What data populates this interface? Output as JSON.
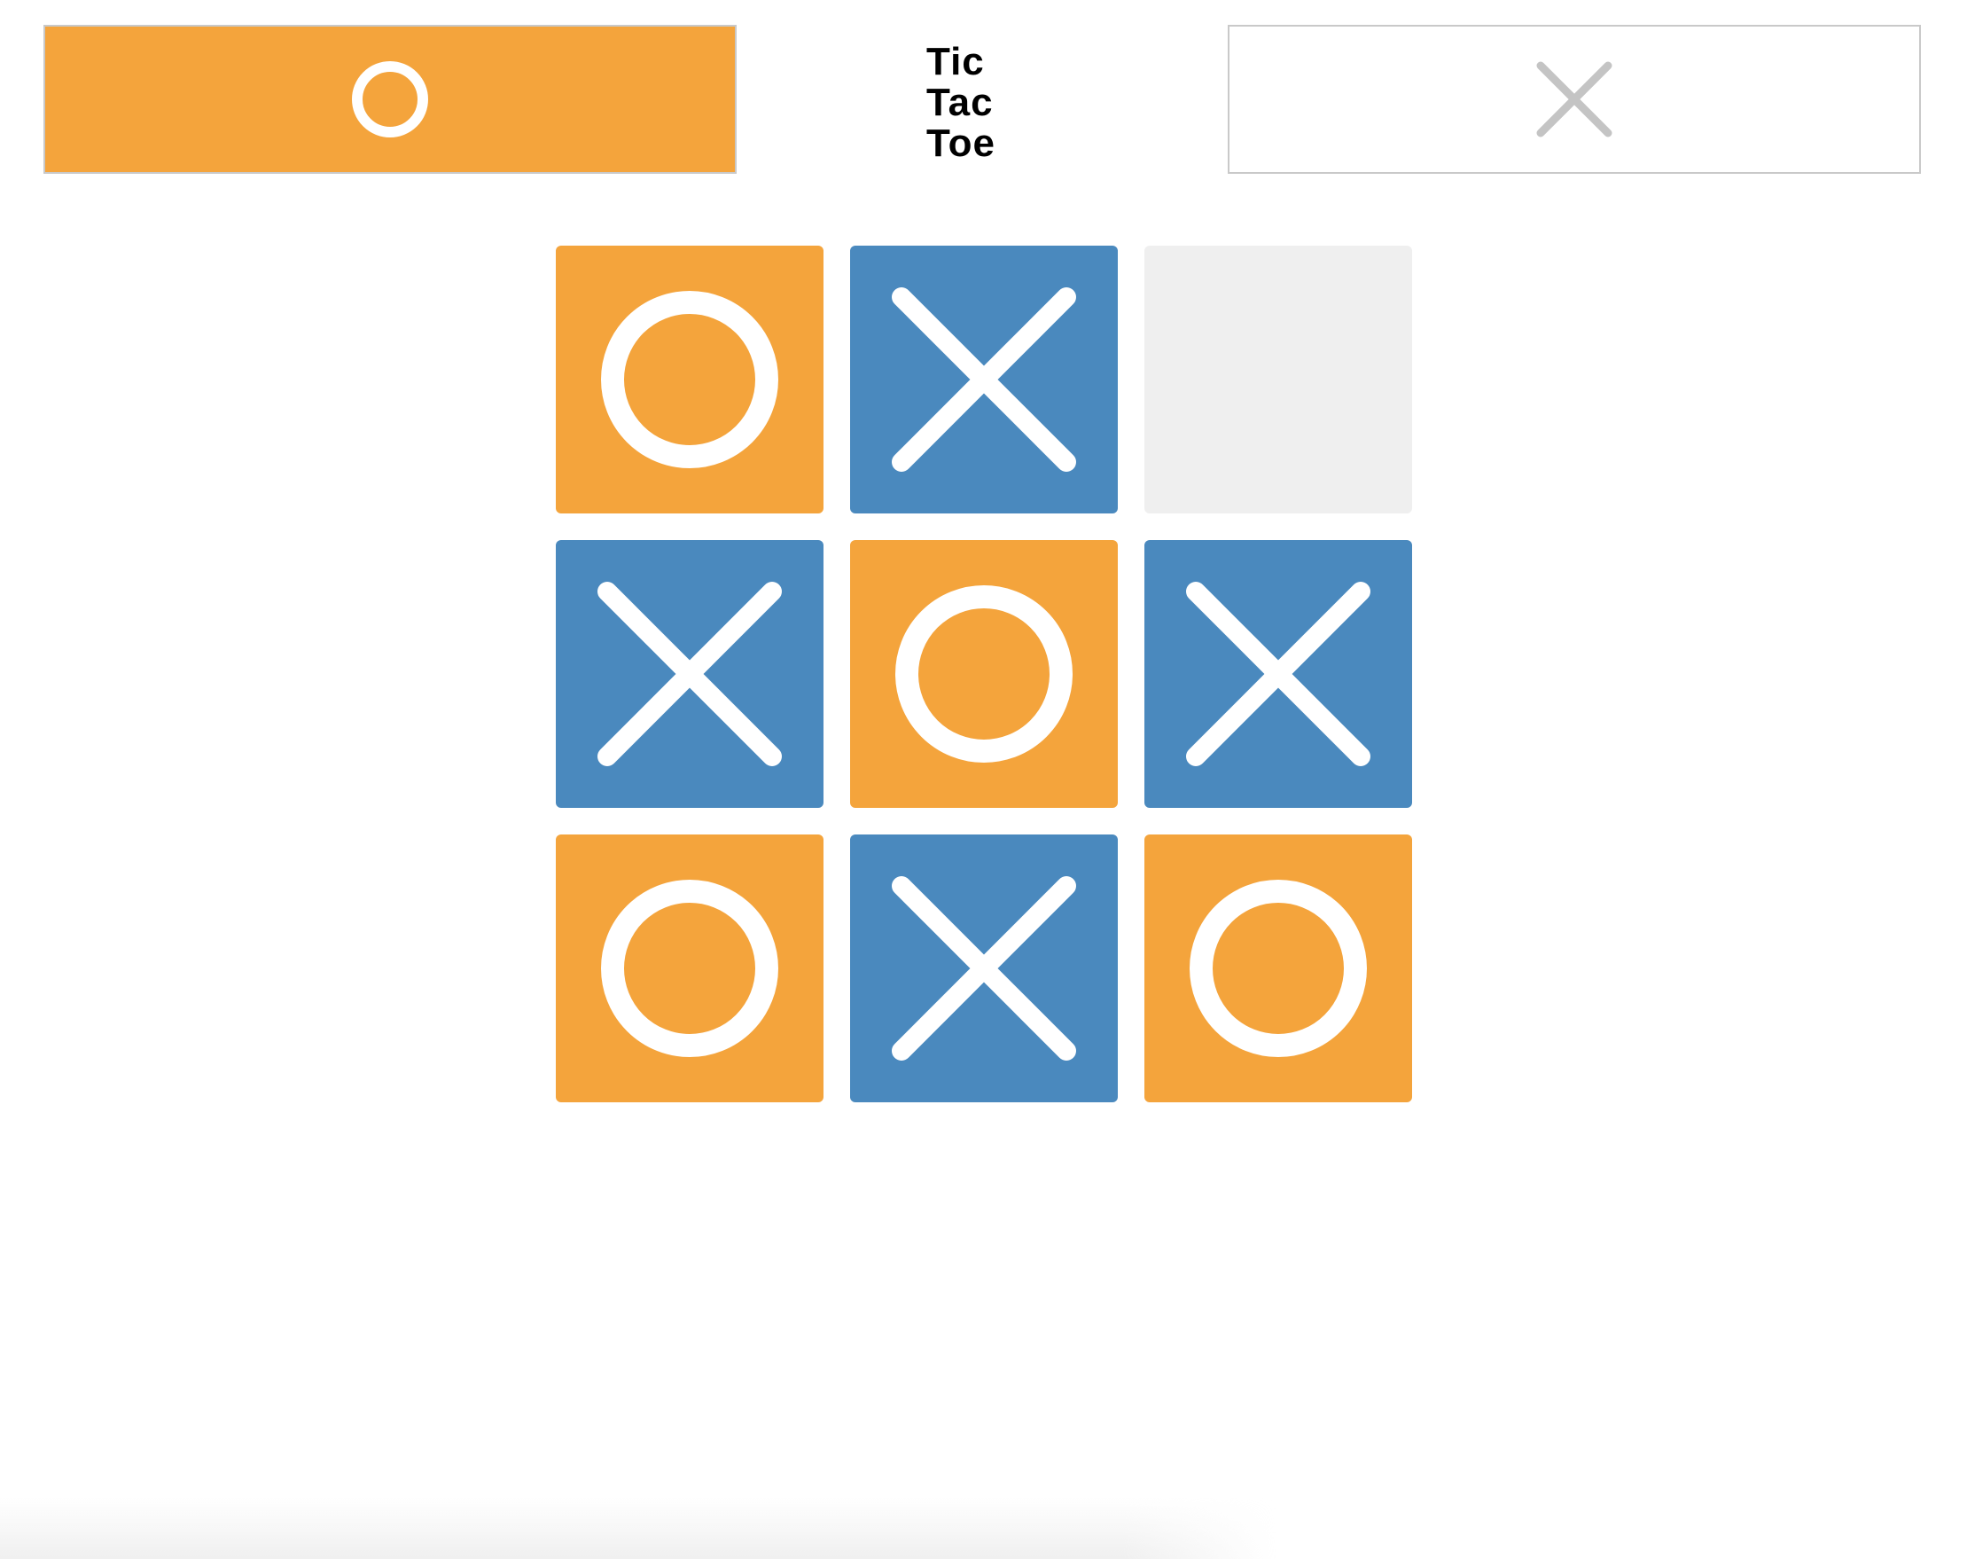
{
  "colors": {
    "o_tile": "#f4a43c",
    "x_tile": "#4a89be",
    "empty_tile": "#efefef",
    "mark": "#ffffff",
    "inactive_mark": "#c4c4c4",
    "panel_border": "#c9c9c9"
  },
  "logo": {
    "lines": [
      "Tic",
      "Tac",
      "Toe"
    ]
  },
  "players": [
    {
      "mark": "O",
      "active": true,
      "icon": "o-icon"
    },
    {
      "mark": "X",
      "active": false,
      "icon": "x-icon"
    }
  ],
  "board": {
    "cells": [
      "O",
      "X",
      "",
      "X",
      "O",
      "X",
      "O",
      "X",
      "O"
    ]
  }
}
